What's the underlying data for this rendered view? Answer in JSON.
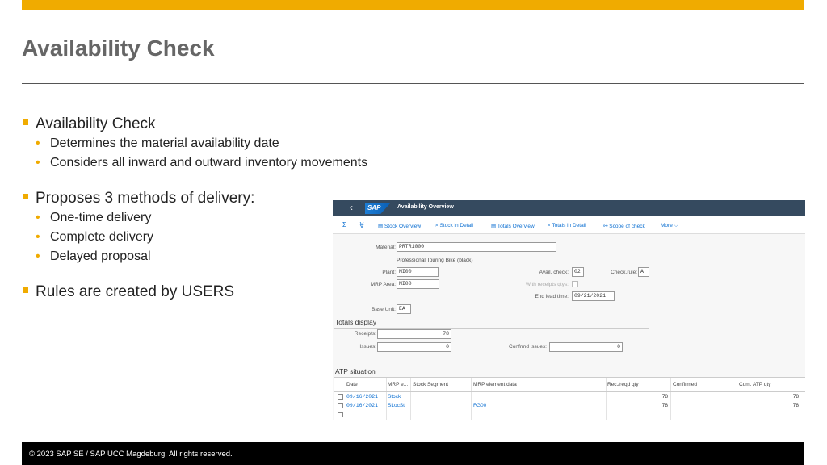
{
  "slide": {
    "title": "Availability Check",
    "footer": "© 2023 SAP SE / SAP UCC Magdeburg. All rights reserved."
  },
  "bullets": [
    {
      "text": "Availability Check",
      "subs": [
        "Determines the material availability date",
        "Considers all inward and outward inventory movements"
      ]
    },
    {
      "text": "Proposes 3 methods of delivery:",
      "subs": [
        "One-time delivery",
        "Complete delivery",
        "Delayed proposal"
      ]
    },
    {
      "text": "Rules are created by USERS",
      "subs": []
    }
  ],
  "sap": {
    "shell": {
      "back": "‹",
      "logo": "SAP",
      "title": "Availability Overview"
    },
    "toolbar": {
      "sum": "Σ",
      "expand": "≫",
      "stock_overview": "Stock Overview",
      "stock_in_detail": "Stock in Detail",
      "totals_overview": "Totals Overview",
      "totals_in_detail": "Totals in Detail",
      "scope_of_check": "Scope of check",
      "more": "More ⌵"
    },
    "form": {
      "material_label": "Material:",
      "material_value": "PRTR1000",
      "material_desc": "Professional Touring Bike (black)",
      "plant_label": "Plant:",
      "plant_value": "MI00",
      "mrp_area_label": "MRP Area:",
      "mrp_area_value": "MI00",
      "base_unit_label": "Base Unit:",
      "base_unit_value": "EA",
      "avail_check_label": "Avail. check:",
      "avail_check_value": "02",
      "check_rule_label": "Check.rule:",
      "check_rule_value": "A",
      "with_receipts_label": "With receipts qtys:",
      "end_lead_time_label": "End lead time:",
      "end_lead_time_value": "09/21/2021"
    },
    "totals": {
      "heading": "Totals display",
      "receipts_label": "Receipts:",
      "receipts_value": "78",
      "issues_label": "Issues:",
      "issues_value": "0",
      "confirmed_issues_label": "Confrmd issues:",
      "confirmed_issues_value": "0"
    },
    "atp": {
      "heading": "ATP situation",
      "columns": [
        "Date",
        "MRP e...",
        "Stock Segment",
        "MRP element data",
        "Rec./reqd qty",
        "Confirmed",
        "Cum. ATP qty"
      ],
      "rows": [
        {
          "date": "09/16/2021",
          "mrp": "Stock",
          "segment": "",
          "element_data": "",
          "qty": "78",
          "confirmed": "",
          "cum": "78"
        },
        {
          "date": "09/16/2021",
          "mrp": "SLocSt",
          "segment": "",
          "element_data": "FG00",
          "qty": "78",
          "confirmed": "",
          "cum": "78"
        }
      ]
    }
  }
}
